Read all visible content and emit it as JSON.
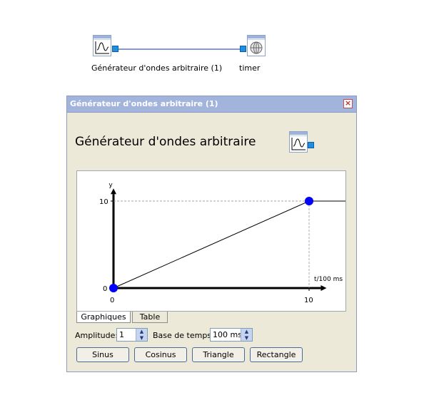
{
  "diagram": {
    "blocks": [
      {
        "label": "Générateur d'ondes arbitraire (1)",
        "icon": "waveform-icon"
      },
      {
        "label": "timer",
        "icon": "globe-icon"
      }
    ]
  },
  "window": {
    "title": "Générateur d'ondes arbitraire (1)",
    "close_label": "×",
    "heading": "Générateur d'ondes arbitraire"
  },
  "chart_data": {
    "type": "line",
    "x": [
      0,
      10,
      11.9
    ],
    "y": [
      0,
      10,
      10
    ],
    "control_points": [
      {
        "x": 0,
        "y": 0
      },
      {
        "x": 10,
        "y": 10
      }
    ],
    "xlabel": "t/100 ms",
    "ylabel": "y",
    "x_ticks": [
      "0",
      "10"
    ],
    "y_ticks": [
      "0",
      "10"
    ],
    "grid": false,
    "line_color": "#000000",
    "point_color": "#0000ff"
  },
  "tabs": [
    {
      "label": "Graphiques",
      "active": true
    },
    {
      "label": "Table",
      "active": false
    }
  ],
  "controls": {
    "amplitude_label": "Amplitude:",
    "amplitude_value": "1",
    "base_label": "Base de temps:",
    "base_value": "100 ms"
  },
  "buttons": {
    "sinus": "Sinus",
    "cosinus": "Cosinus",
    "triangle": "Triangle",
    "rectangle": "Rectangle"
  },
  "colors": {
    "title_bar": "#a2b4db",
    "window_bg": "#ece9d8",
    "port": "#1e8fe0",
    "link": "#8a97c8"
  }
}
